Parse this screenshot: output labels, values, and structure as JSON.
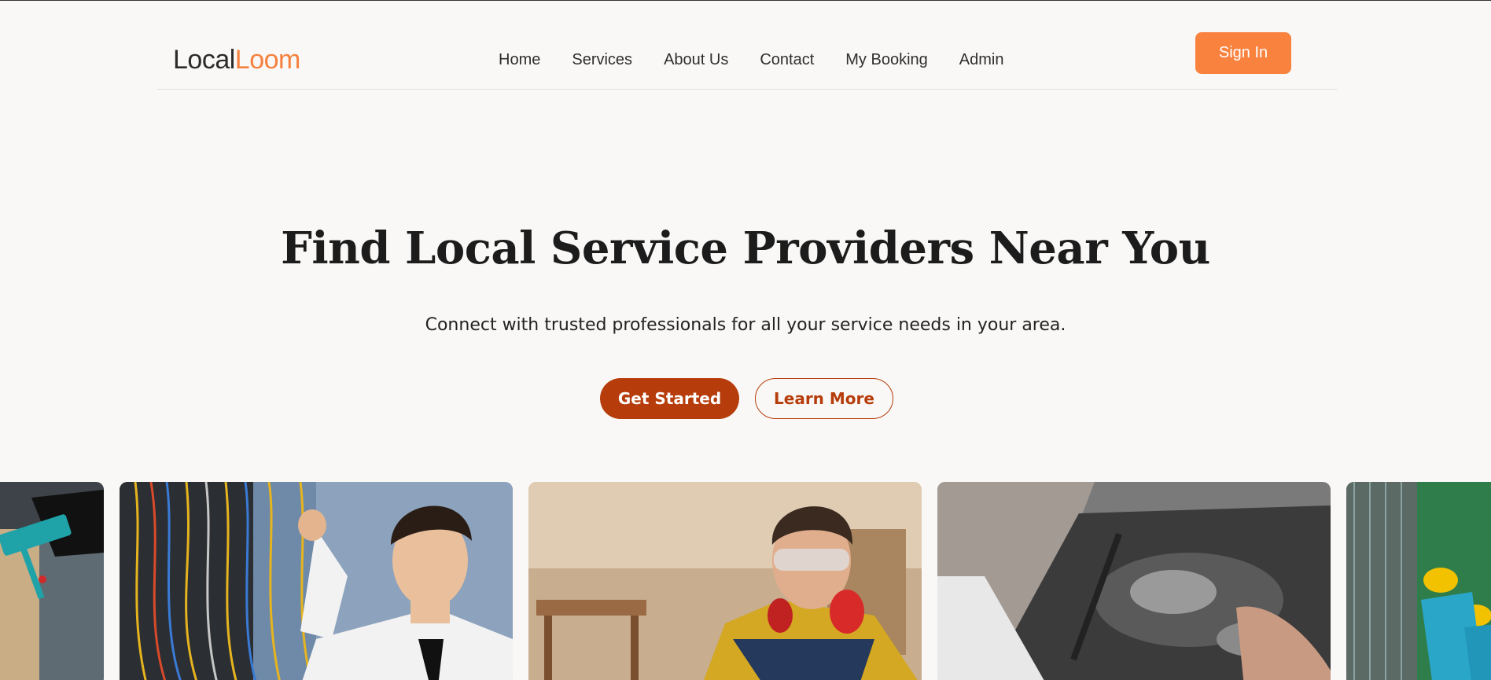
{
  "header": {
    "logo": {
      "part1": "Local",
      "part2": "Loom"
    },
    "nav": [
      {
        "label": "Home"
      },
      {
        "label": "Services"
      },
      {
        "label": "About Us"
      },
      {
        "label": "Contact"
      },
      {
        "label": "My Booking"
      },
      {
        "label": "Admin"
      }
    ],
    "sign_in_label": "Sign In"
  },
  "hero": {
    "title": "Find Local Service Providers Near You",
    "subtitle": "Connect with trusted professionals for all your service needs in your area.",
    "primary_button": "Get Started",
    "secondary_button": "Learn More"
  },
  "gallery": [
    {
      "name": "cleaner-photo"
    },
    {
      "name": "electrician-photo"
    },
    {
      "name": "carpenter-photo"
    },
    {
      "name": "mechanic-photo"
    },
    {
      "name": "construction-worker-photo"
    }
  ],
  "colors": {
    "background": "#f9f8f6",
    "accent": "#f9823f",
    "primary": "#b63d0b"
  }
}
